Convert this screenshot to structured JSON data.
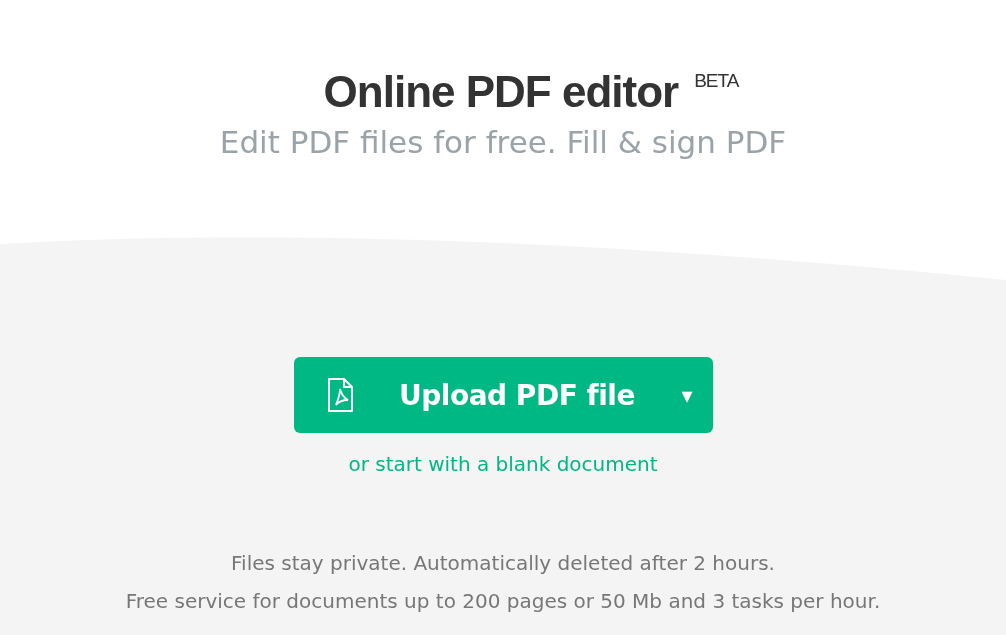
{
  "header": {
    "title": "Online PDF editor",
    "badge": "BETA",
    "subtitle": "Edit PDF files for free. Fill & sign PDF"
  },
  "upload": {
    "button": "Upload PDF file",
    "caret": "▾",
    "link": "or start with a blank document"
  },
  "notes": [
    "Files stay private. Automatically deleted after 2 hours.",
    "Free service for documents up to 200 pages or 50 Mb and 3 tasks per hour."
  ]
}
